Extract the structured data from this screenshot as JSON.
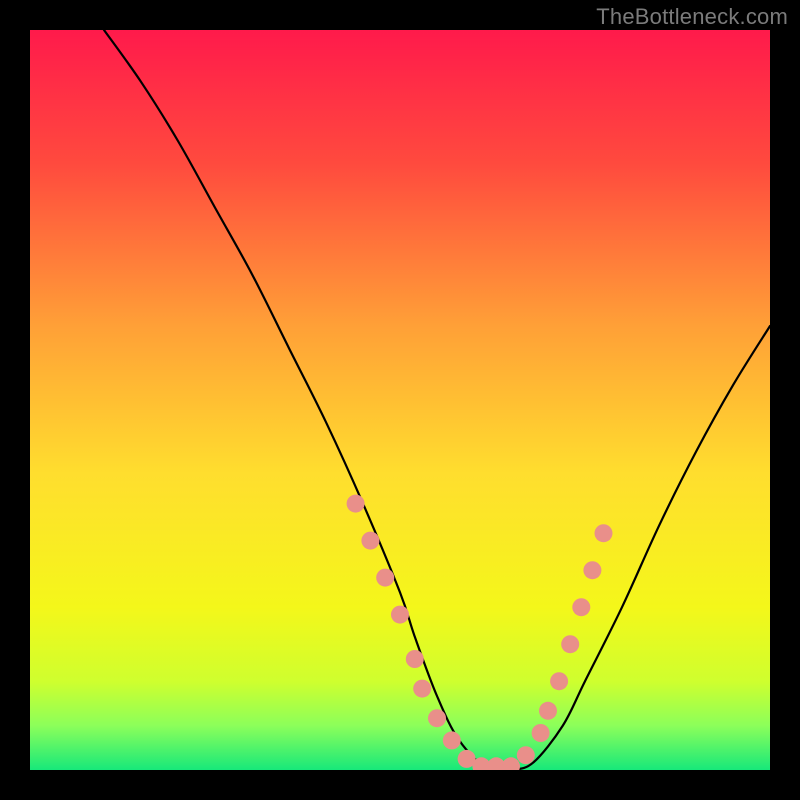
{
  "attribution": "TheBottleneck.com",
  "chart_data": {
    "type": "line",
    "title": "",
    "xlabel": "",
    "ylabel": "",
    "xlim": [
      0,
      100
    ],
    "ylim": [
      0,
      100
    ],
    "gradient_stops": [
      {
        "offset": 0,
        "color": "#ff1a4b"
      },
      {
        "offset": 18,
        "color": "#ff4a3e"
      },
      {
        "offset": 40,
        "color": "#ffa037"
      },
      {
        "offset": 60,
        "color": "#ffde2e"
      },
      {
        "offset": 78,
        "color": "#f4f71a"
      },
      {
        "offset": 88,
        "color": "#cfff2e"
      },
      {
        "offset": 94,
        "color": "#8cff5a"
      },
      {
        "offset": 100,
        "color": "#17e87a"
      }
    ],
    "curve": {
      "x": [
        10,
        15,
        20,
        25,
        30,
        35,
        40,
        45,
        50,
        52,
        55,
        58,
        62,
        65,
        68,
        72,
        75,
        80,
        85,
        90,
        95,
        100
      ],
      "y": [
        100,
        93,
        85,
        76,
        67,
        57,
        47,
        36,
        24,
        18,
        10,
        4,
        0,
        0,
        1,
        6,
        12,
        22,
        33,
        43,
        52,
        60
      ]
    },
    "markers": {
      "color": "#e98f8a",
      "radius": 9,
      "points": [
        {
          "x": 44,
          "y": 36
        },
        {
          "x": 46,
          "y": 31
        },
        {
          "x": 48,
          "y": 26
        },
        {
          "x": 50,
          "y": 21
        },
        {
          "x": 52,
          "y": 15
        },
        {
          "x": 53,
          "y": 11
        },
        {
          "x": 55,
          "y": 7
        },
        {
          "x": 57,
          "y": 4
        },
        {
          "x": 59,
          "y": 1.5
        },
        {
          "x": 61,
          "y": 0.5
        },
        {
          "x": 63,
          "y": 0.5
        },
        {
          "x": 65,
          "y": 0.5
        },
        {
          "x": 67,
          "y": 2
        },
        {
          "x": 69,
          "y": 5
        },
        {
          "x": 70,
          "y": 8
        },
        {
          "x": 71.5,
          "y": 12
        },
        {
          "x": 73,
          "y": 17
        },
        {
          "x": 74.5,
          "y": 22
        },
        {
          "x": 76,
          "y": 27
        },
        {
          "x": 77.5,
          "y": 32
        }
      ]
    }
  }
}
